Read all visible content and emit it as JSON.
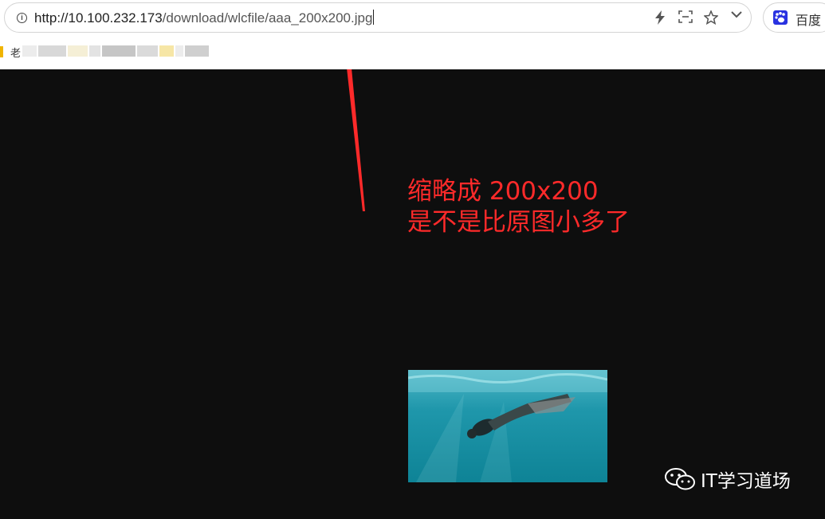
{
  "browser": {
    "url_host": "http://10.100.232.173",
    "url_path": "/download/wlcfile/aaa_200x200.jpg",
    "search_engine_label": "百度",
    "bookmark_label": "老"
  },
  "annotation": {
    "line1": "缩略成 200x200",
    "line2": "是不是比原图小多了",
    "color": "#ff2a2a"
  },
  "watermark": {
    "text": "IT学习道场"
  },
  "icons": {
    "info": "info-icon",
    "bolt": "lightning-icon",
    "screenshot": "screenshot-icon",
    "star": "star-icon",
    "chevron": "chevron-down-icon",
    "baidu": "baidu-paw-icon",
    "wechat": "wechat-icon",
    "arrow": "red-arrow-annotation"
  }
}
